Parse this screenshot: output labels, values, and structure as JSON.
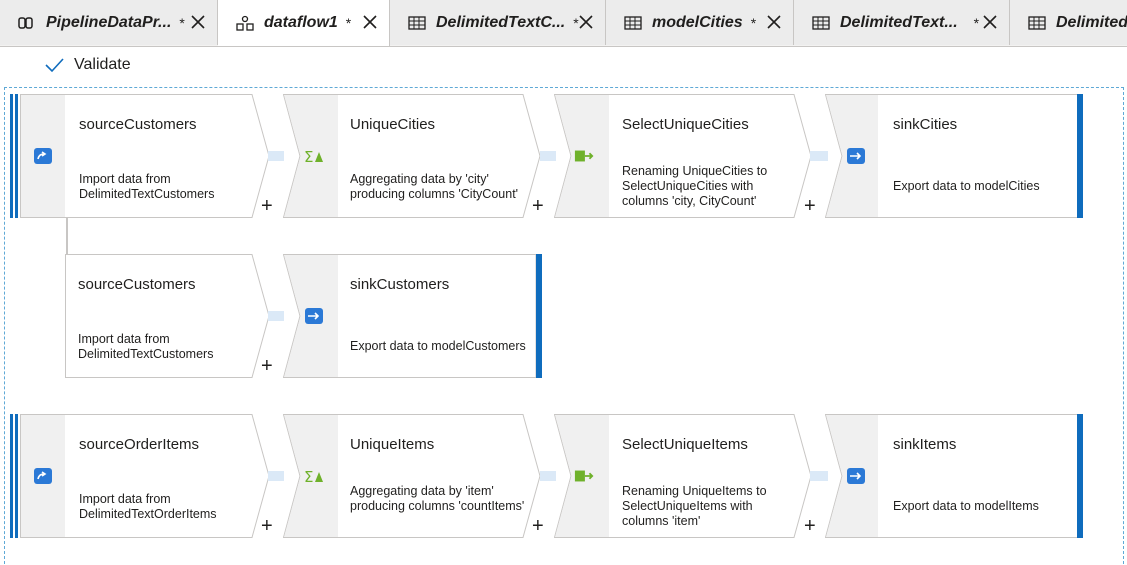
{
  "tabs": [
    {
      "label": "PipelineDataPr...",
      "star": "*",
      "icon": "pipeline-icon"
    },
    {
      "label": "dataflow1",
      "star": "*",
      "icon": "dataflow-icon"
    },
    {
      "label": "DelimitedTextC...",
      "star": "*",
      "icon": "table-icon"
    },
    {
      "label": "modelCities",
      "star": "*",
      "icon": "table-icon"
    },
    {
      "label": "DelimitedText...",
      "star": "*",
      "icon": "table-icon"
    },
    {
      "label": "Delimited",
      "star": "",
      "icon": "table-icon"
    }
  ],
  "toolbar": {
    "validate_label": "Validate"
  },
  "flow1": {
    "source": {
      "title": "sourceCustomers",
      "desc": "Import data from DelimitedTextCustomers"
    },
    "aggregate": {
      "title": "UniqueCities",
      "desc": "Aggregating data by 'city' producing columns 'CityCount'"
    },
    "select": {
      "title": "SelectUniqueCities",
      "desc": "Renaming UniqueCities to SelectUniqueCities with columns 'city, CityCount'"
    },
    "sink": {
      "title": "sinkCities",
      "desc": "Export data to modelCities"
    }
  },
  "flow2": {
    "source": {
      "title": "sourceCustomers",
      "desc": "Import data from DelimitedTextCustomers"
    },
    "sink": {
      "title": "sinkCustomers",
      "desc": "Export data to modelCustomers"
    }
  },
  "flow3": {
    "source": {
      "title": "sourceOrderItems",
      "desc": "Import data from DelimitedTextOrderItems"
    },
    "aggregate": {
      "title": "UniqueItems",
      "desc": "Aggregating data by 'item' producing columns 'countItems'"
    },
    "select": {
      "title": "SelectUniqueItems",
      "desc": "Renaming UniqueItems to SelectUniqueItems with columns 'item'"
    },
    "sink": {
      "title": "sinkItems",
      "desc": "Export data to modelItems"
    }
  },
  "plus_label": "+",
  "colors": {
    "accent": "#0f6cbd",
    "connector": "#dbe9f7",
    "icon_blue": "#2b79d6",
    "icon_green": "#6fb12b"
  }
}
